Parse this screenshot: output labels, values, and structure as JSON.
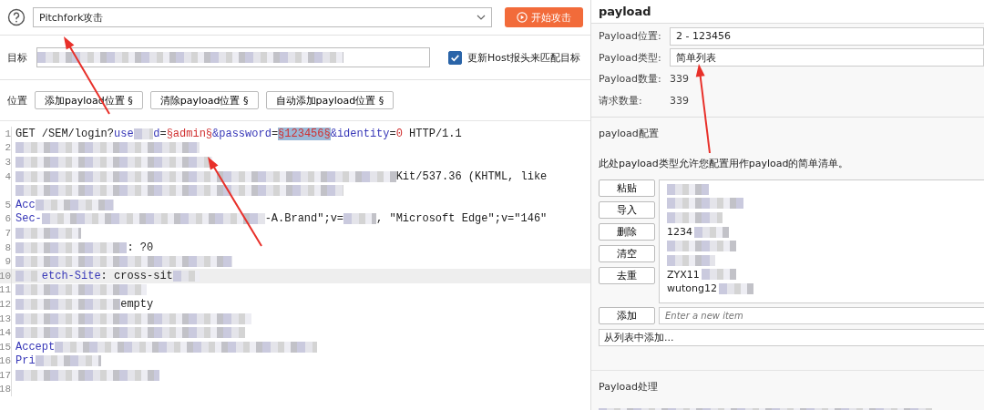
{
  "attack": {
    "attack_type": "Pitchfork攻击",
    "start_button": "开始攻击"
  },
  "target": {
    "label": "目标",
    "update_host": {
      "label": "更新Host报头来匹配目标",
      "checked": true
    }
  },
  "positions": {
    "label": "位置",
    "buttons": [
      "添加payload位置 §",
      "清除payload位置 §",
      "自动添加payload位置 §"
    ]
  },
  "editor": {
    "lines": [
      {
        "number": "1",
        "highlighted": false,
        "segments": [
          {
            "kind": "plain",
            "text": "GET /SEM/login?"
          },
          {
            "kind": "key",
            "text": "use"
          },
          {
            "kind": "blur"
          },
          {
            "kind": "key",
            "text": "d"
          },
          {
            "kind": "plain",
            "text": "="
          },
          {
            "kind": "marker",
            "text": "§admin§",
            "selected": false
          },
          {
            "kind": "key",
            "text": "&password"
          },
          {
            "kind": "plain",
            "text": "="
          },
          {
            "kind": "marker",
            "text": "§123456§",
            "selected": true
          },
          {
            "kind": "key",
            "text": "&identity"
          },
          {
            "kind": "plain",
            "text": "="
          },
          {
            "kind": "number",
            "text": "0"
          },
          {
            "kind": "plain",
            "text": " HTTP/1.1"
          }
        ]
      },
      {
        "number": "2",
        "highlighted": false,
        "segments": [
          {
            "kind": "blur"
          }
        ]
      },
      {
        "number": "3",
        "highlighted": false,
        "segments": [
          {
            "kind": "blur"
          }
        ]
      },
      {
        "number": "4",
        "highlighted": false,
        "segments": [
          {
            "kind": "blur"
          },
          {
            "kind": "plain",
            "text": "Kit/537.36 (KHTML, like"
          }
        ]
      },
      {
        "highlighted": false,
        "segments": [
          {
            "kind": "blur"
          }
        ]
      },
      {
        "number": "5",
        "highlighted": false,
        "segments": [
          {
            "kind": "key",
            "text": "Acc"
          },
          {
            "kind": "blur"
          }
        ]
      },
      {
        "number": "6",
        "highlighted": false,
        "segments": [
          {
            "kind": "key",
            "text": "Sec-"
          },
          {
            "kind": "blur"
          },
          {
            "kind": "plain",
            "text": "-A.Brand\";v="
          },
          {
            "kind": "blur"
          },
          {
            "kind": "plain",
            "text": ", \"Microsoft Edge\";v=\"146\""
          }
        ]
      },
      {
        "number": "7",
        "highlighted": false,
        "segments": [
          {
            "kind": "blur"
          }
        ]
      },
      {
        "number": "8",
        "highlighted": false,
        "segments": [
          {
            "kind": "blur"
          },
          {
            "kind": "plain",
            "text": ": ?0"
          }
        ]
      },
      {
        "number": "9",
        "highlighted": false,
        "segments": [
          {
            "kind": "blur"
          }
        ]
      },
      {
        "number": "10",
        "highlighted": true,
        "segments": [
          {
            "kind": "blur"
          },
          {
            "kind": "key",
            "text": "etch-Site"
          },
          {
            "kind": "plain",
            "text": ": cross-sit"
          },
          {
            "kind": "blur"
          }
        ]
      },
      {
        "number": "11",
        "highlighted": false,
        "segments": [
          {
            "kind": "blur"
          }
        ]
      },
      {
        "number": "12",
        "highlighted": false,
        "segments": [
          {
            "kind": "blur"
          },
          {
            "kind": "plain",
            "text": "empty"
          }
        ]
      },
      {
        "number": "13",
        "highlighted": false,
        "segments": [
          {
            "kind": "blur"
          }
        ]
      },
      {
        "number": "14",
        "highlighted": false,
        "segments": [
          {
            "kind": "blur"
          }
        ]
      },
      {
        "number": "15",
        "highlighted": false,
        "segments": [
          {
            "kind": "key",
            "text": "Accept"
          },
          {
            "kind": "blur"
          }
        ]
      },
      {
        "number": "16",
        "highlighted": false,
        "segments": [
          {
            "kind": "key",
            "text": "Pri"
          },
          {
            "kind": "blur"
          }
        ]
      },
      {
        "number": "17",
        "highlighted": false,
        "segments": [
          {
            "kind": "blur"
          }
        ]
      },
      {
        "number": "18",
        "highlighted": false
      }
    ]
  },
  "payload_panel": {
    "title": "payload",
    "fields": [
      {
        "kind": "field",
        "label": "Payload位置:",
        "value": "2 - 123456"
      },
      {
        "kind": "field",
        "label": "Payload类型:",
        "value": "简单列表"
      },
      {
        "kind": "info",
        "label": "Payload数量:",
        "value": "339"
      },
      {
        "kind": "info",
        "label": "请求数量:",
        "value": "339"
      }
    ],
    "config_title": "payload配置",
    "description": "此处payload类型允许您配置用作payload的简单清单。",
    "list_buttons": [
      "粘贴",
      "导入",
      "删除",
      "清空",
      "去重"
    ],
    "items": [
      {
        "kind": "blurred"
      },
      {
        "kind": "blurred"
      },
      {
        "kind": "blurred"
      },
      {
        "kind": "text",
        "text": "1234"
      },
      {
        "kind": "blurred"
      },
      {
        "kind": "blurred"
      },
      {
        "kind": "text",
        "text": "ZYX11"
      },
      {
        "kind": "text",
        "text": "wutong12"
      }
    ],
    "add_button": "添加",
    "add_placeholder": "Enter a new item",
    "add_from_list": "从列表中添加...",
    "processing_title": "Payload处理"
  },
  "annotations": [
    {
      "kind": "arrow"
    },
    {
      "kind": "arrow"
    },
    {
      "kind": "arrow"
    }
  ]
}
